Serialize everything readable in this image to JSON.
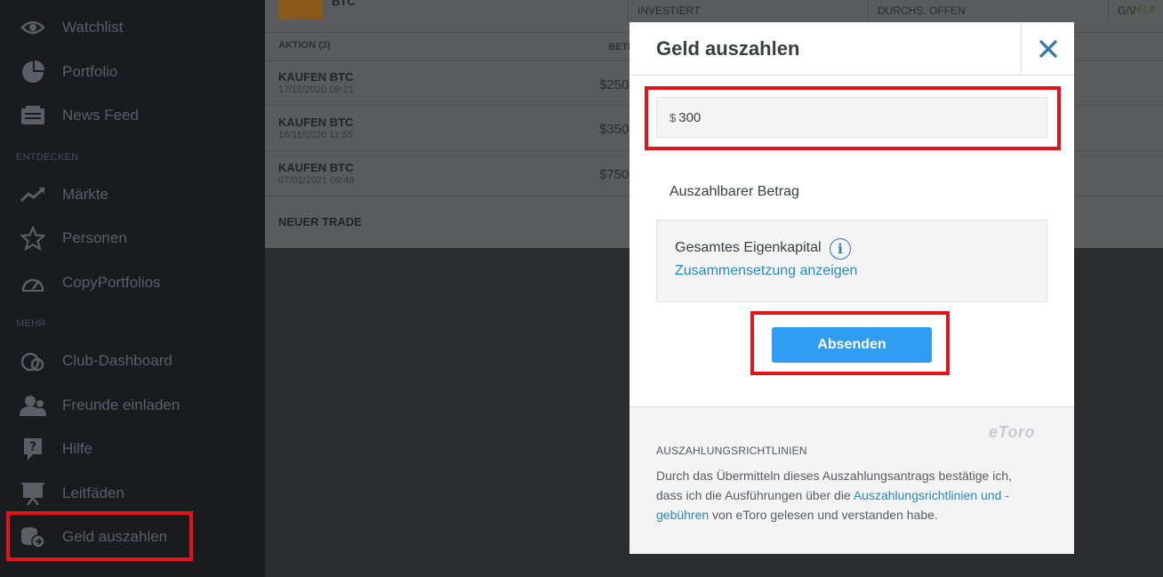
{
  "sidebar": {
    "items": [
      {
        "label": "Watchlist",
        "icon": "eye-icon"
      },
      {
        "label": "Portfolio",
        "icon": "pie-chart-icon"
      },
      {
        "label": "News Feed",
        "icon": "news-icon"
      },
      {
        "label": "Märkte",
        "icon": "trend-icon"
      },
      {
        "label": "Personen",
        "icon": "star-icon"
      },
      {
        "label": "CopyPortfolios",
        "icon": "gauge-icon"
      },
      {
        "label": "Club-Dashboard",
        "icon": "club-icon"
      },
      {
        "label": "Freunde einladen",
        "icon": "people-icon"
      },
      {
        "label": "Hilfe",
        "icon": "help-icon"
      },
      {
        "label": "Leitfäden",
        "icon": "presentation-icon"
      },
      {
        "label": "Geld auszahlen",
        "icon": "withdraw-coins-icon"
      }
    ],
    "sections": {
      "discover": "ENTDECKEN",
      "more": "MEHR"
    }
  },
  "main": {
    "asset": "BTC",
    "columns": {
      "invested": "INVESTIERT",
      "avg_open": "DURCHS. OFFEN",
      "pl": "G/V",
      "pl_value": "(47.6"
    },
    "actions_header": "AKTION (3)",
    "amount_header": "BETR",
    "trades": [
      {
        "action": "KAUFEN BTC",
        "date": "17/11/2020 09:21",
        "amount": "$250"
      },
      {
        "action": "KAUFEN BTC",
        "date": "18/11/2020 11:55",
        "amount": "$350"
      },
      {
        "action": "KAUFEN BTC",
        "date": "07/01/2021 09:49",
        "amount": "$750"
      }
    ],
    "new_trade": "NEUER TRADE"
  },
  "modal": {
    "title": "Geld auszahlen",
    "currency": "$",
    "amount": "300",
    "withdrawable_label": "Auszahlbarer Betrag",
    "equity_label": "Gesamtes Eigenkapital",
    "composition_link": "Zusammensetzung anzeigen",
    "submit_label": "Absenden",
    "logo": "eToro",
    "policy_title": "AUSZAHLUNGSRICHTLINIEN",
    "policy_text_before": "Durch das Übermitteln dieses Auszahlungsantrags bestätige ich, dass ich die Ausführungen über die ",
    "policy_link": "Auszahlungsrichtlinien und -gebühren",
    "policy_text_after": " von eToro gelesen und verstanden habe."
  },
  "colors": {
    "accent": "#2e9cf0",
    "highlight": "#e3131b",
    "link": "#2a8ab8"
  }
}
